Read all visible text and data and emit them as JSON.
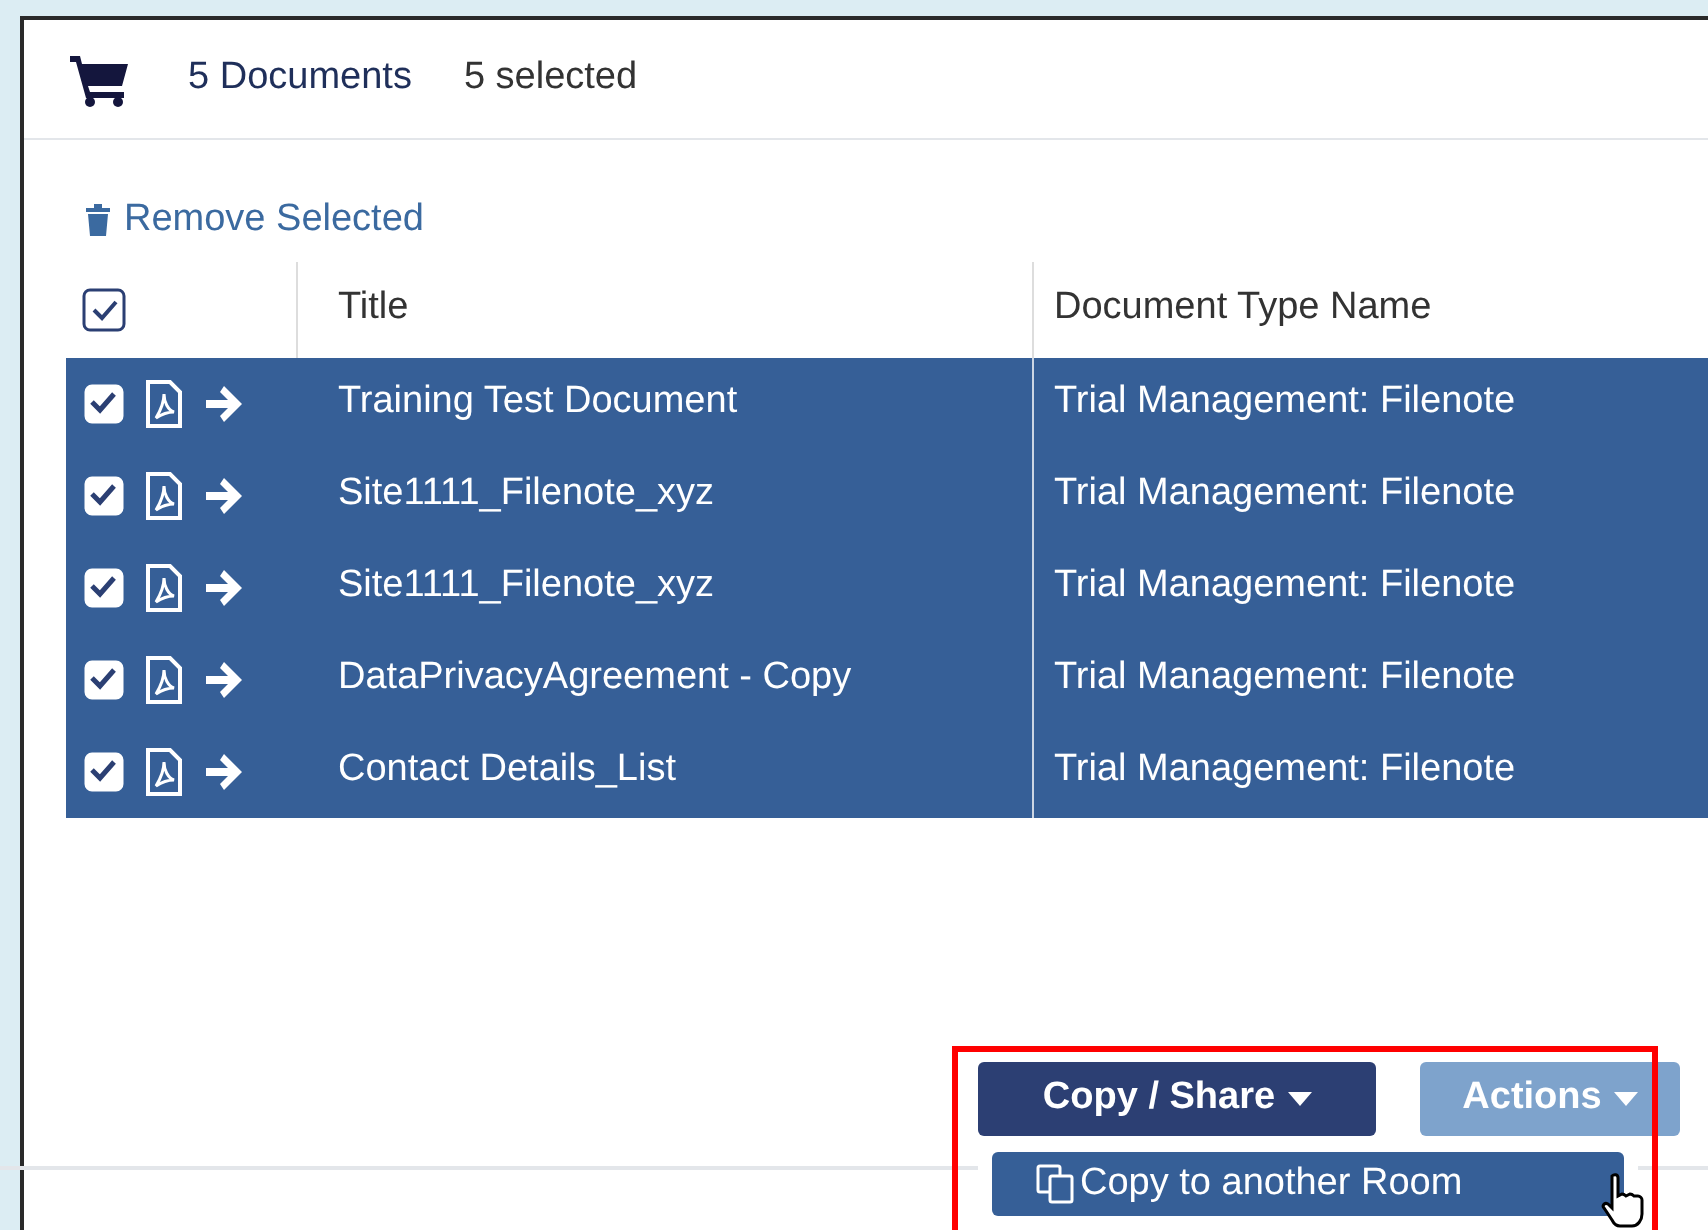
{
  "header": {
    "count": "5 Documents",
    "selected_count": "5 selected"
  },
  "remove_link": "Remove Selected",
  "table": {
    "select_all_checked": true,
    "columns": [
      "Title",
      "Document Type Name"
    ],
    "rows": [
      {
        "title": "Training Test Document",
        "type": "Trial Management: Filenote",
        "checked": true,
        "selected": true
      },
      {
        "title": "Site1111_Filenote_xyz",
        "type": "Trial Management: Filenote",
        "checked": true,
        "selected": true
      },
      {
        "title": "Site1111_Filenote_xyz",
        "type": "Trial Management: Filenote",
        "checked": true,
        "selected": true
      },
      {
        "title": "DataPrivacyAgreement - Copy",
        "type": "Trial Management: Filenote",
        "checked": true,
        "selected": true
      },
      {
        "title": "Contact Details_List",
        "type": "Trial Management: Filenote",
        "checked": true,
        "selected": true
      }
    ]
  },
  "buttons": [
    {
      "label": "Copy / Share",
      "kind": "primary"
    },
    {
      "label": "Actions",
      "kind": "secondary"
    }
  ],
  "dropdown": {
    "items": [
      "Copy to another Room"
    ]
  }
}
